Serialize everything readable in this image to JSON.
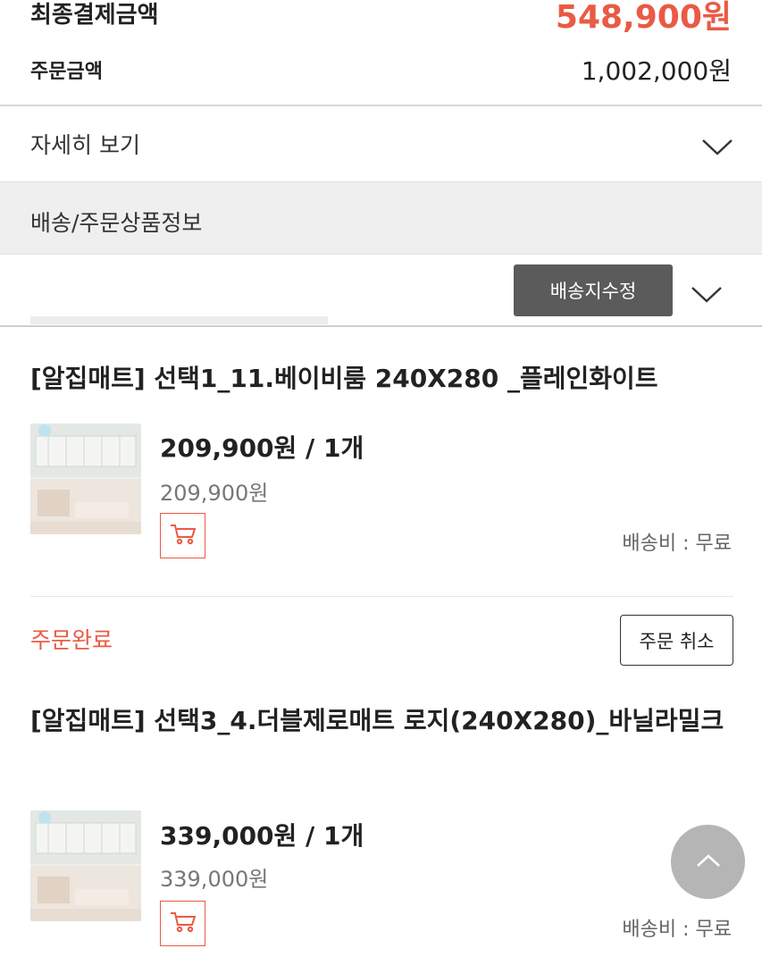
{
  "summary": {
    "final_label": "최종결제금액",
    "final_amount": "548,900원",
    "order_label": "주문금액",
    "order_amount": "1,002,000원"
  },
  "details": {
    "label": "자세히 보기",
    "icon": "chevron-down-icon"
  },
  "section": {
    "title": "배송/주문상품정보"
  },
  "address": {
    "edit_label": "배송지수정",
    "icon": "chevron-down-icon"
  },
  "items": [
    {
      "title": "[알집매트] 선택1_11.베이비룸 240X280 _플레인화이트",
      "price_qty": "209,900원 / 1개",
      "price": "209,900원",
      "shipping": "배송비 : 무료",
      "cart_icon": "cart-icon"
    },
    {
      "title": "[알집매트] 선택3_4.더블제로매트 로지(240X280)_바닐라밀크",
      "price_qty": "339,000원 / 1개",
      "price": "339,000원",
      "shipping": "배송비 : 무료",
      "cart_icon": "cart-icon"
    }
  ],
  "order_status": {
    "status": "주문완료",
    "cancel_label": "주문 취소"
  },
  "scroll_top": {
    "icon": "chevron-up-icon"
  },
  "colors": {
    "accent": "#ea5a44",
    "button_dark": "#5b5b5b",
    "section_bg": "#efefef"
  }
}
